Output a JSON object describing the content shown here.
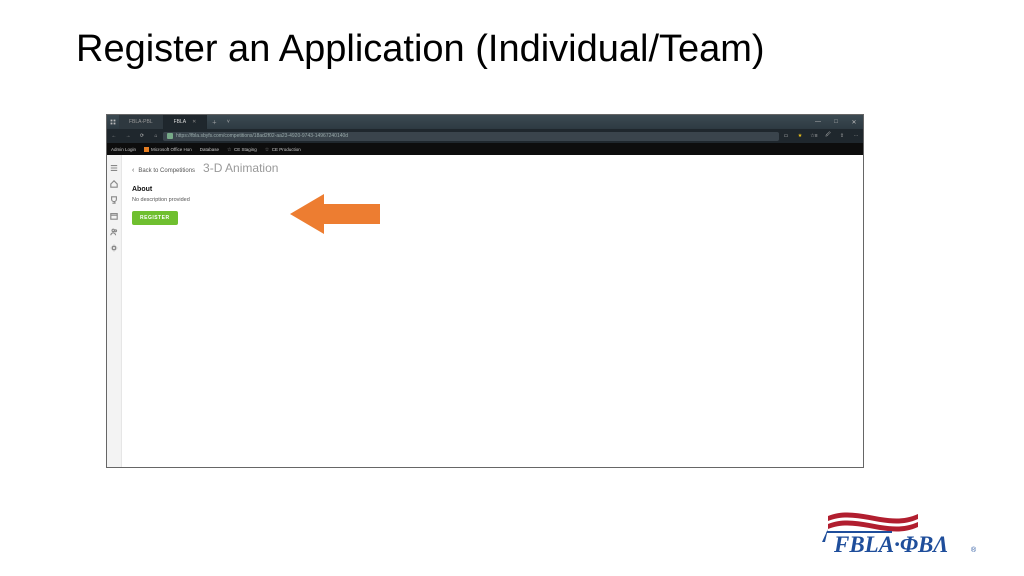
{
  "slide": {
    "title": "Register an Application (Individual/Team)"
  },
  "browser": {
    "tabs": {
      "inactive": "FBLA-PBL",
      "active": "FBLA"
    },
    "url": "https://fbla.sbyfs.com/competitions/18ad2f02-aa23-4920-9743-14967240140d",
    "bookmarks": {
      "admin": "Admin Login",
      "office": "Microsoft Office Hon",
      "database": "Database",
      "staging": "CE Staging",
      "production": "CE Production"
    }
  },
  "page": {
    "back_label": "Back to Competitions",
    "title": "3-D Animation",
    "about_heading": "About",
    "about_text": "No description provided",
    "register_label": "REGISTER"
  },
  "logo": {
    "text": "FBLA·ΦΒΛ",
    "mark": "®"
  }
}
